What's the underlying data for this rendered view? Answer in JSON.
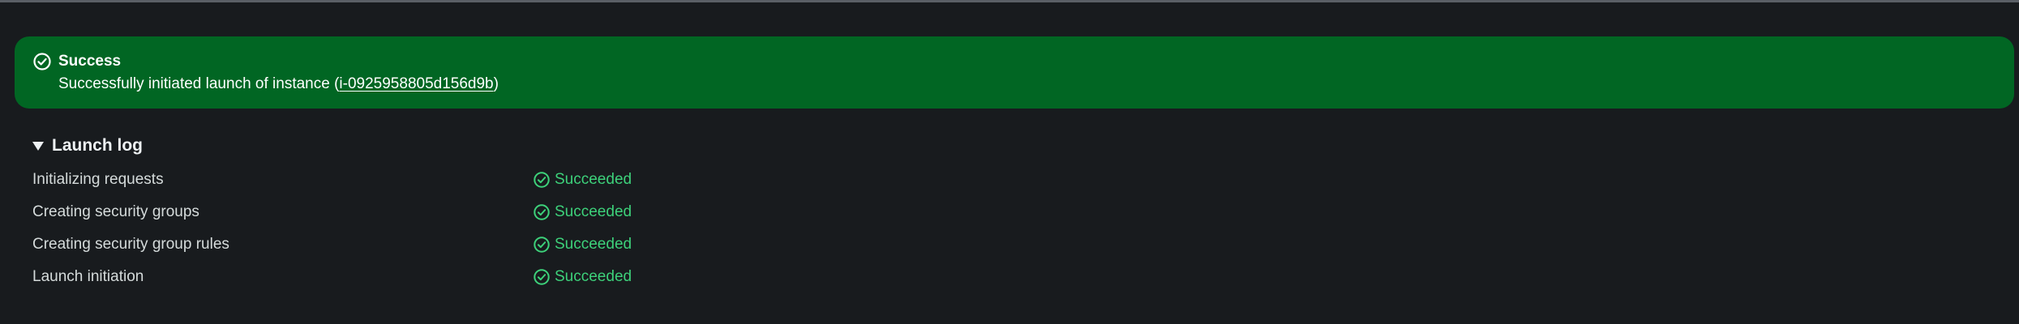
{
  "colors": {
    "background": "#181b1e",
    "banner_bg": "#016623",
    "success_text": "#3dd17a",
    "text": "#d5dbdb"
  },
  "banner": {
    "icon": "check-circle-icon",
    "title": "Success",
    "message_prefix": "Successfully initiated launch of instance (",
    "instance_id": "i-0925958805d156d9b",
    "message_suffix": ")"
  },
  "launch_log": {
    "title": "Launch log",
    "expanded": true,
    "rows": [
      {
        "label": "Initializing requests",
        "status": "Succeeded",
        "status_icon": "check-circle-icon"
      },
      {
        "label": "Creating security groups",
        "status": "Succeeded",
        "status_icon": "check-circle-icon"
      },
      {
        "label": "Creating security group rules",
        "status": "Succeeded",
        "status_icon": "check-circle-icon"
      },
      {
        "label": "Launch initiation",
        "status": "Succeeded",
        "status_icon": "check-circle-icon"
      }
    ]
  }
}
